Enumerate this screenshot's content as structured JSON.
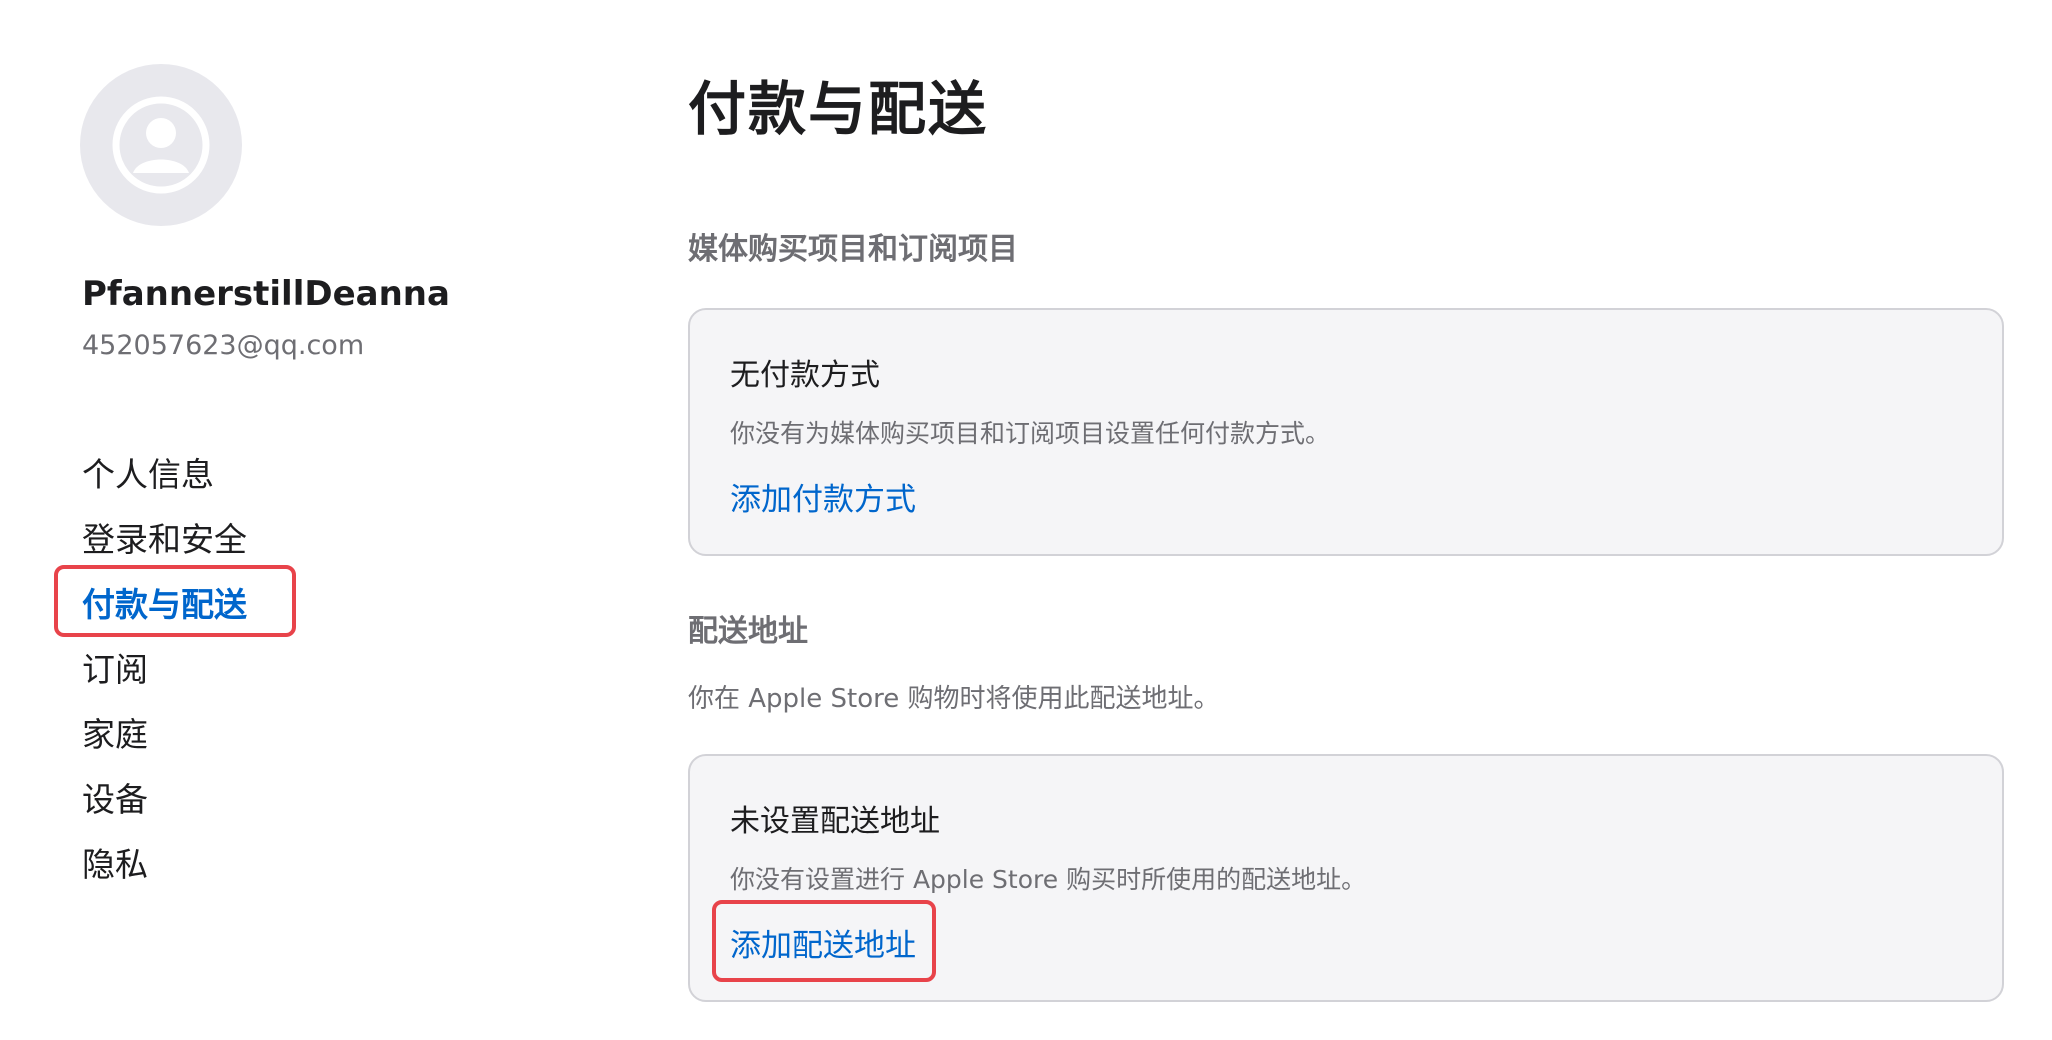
{
  "profile": {
    "avatar_icon": "person-circle-icon",
    "name": "PfannerstillDeanna",
    "email": "452057623@qq.com"
  },
  "sidebar": {
    "items": [
      {
        "label": "个人信息",
        "active": false
      },
      {
        "label": "登录和安全",
        "active": false
      },
      {
        "label": "付款与配送",
        "active": true
      },
      {
        "label": "订阅",
        "active": false
      },
      {
        "label": "家庭",
        "active": false
      },
      {
        "label": "设备",
        "active": false
      },
      {
        "label": "隐私",
        "active": false
      }
    ]
  },
  "main": {
    "title": "付款与配送",
    "payment": {
      "section_title": "媒体购买项目和订阅项目",
      "card_title": "无付款方式",
      "card_desc": "你没有为媒体购买项目和订阅项目设置任何付款方式。",
      "card_link": "添加付款方式"
    },
    "shipping": {
      "section_title": "配送地址",
      "section_desc": "你在 Apple Store 购物时将使用此配送地址。",
      "card_title": "未设置配送地址",
      "card_desc": "你没有设置进行 Apple Store 购买时所使用的配送地址。",
      "card_link": "添加配送地址"
    }
  },
  "colors": {
    "accent_link": "#0066cc",
    "highlight_annotation": "#e8434a",
    "card_background": "#f5f5f7",
    "secondary_text": "#6e6e73"
  }
}
